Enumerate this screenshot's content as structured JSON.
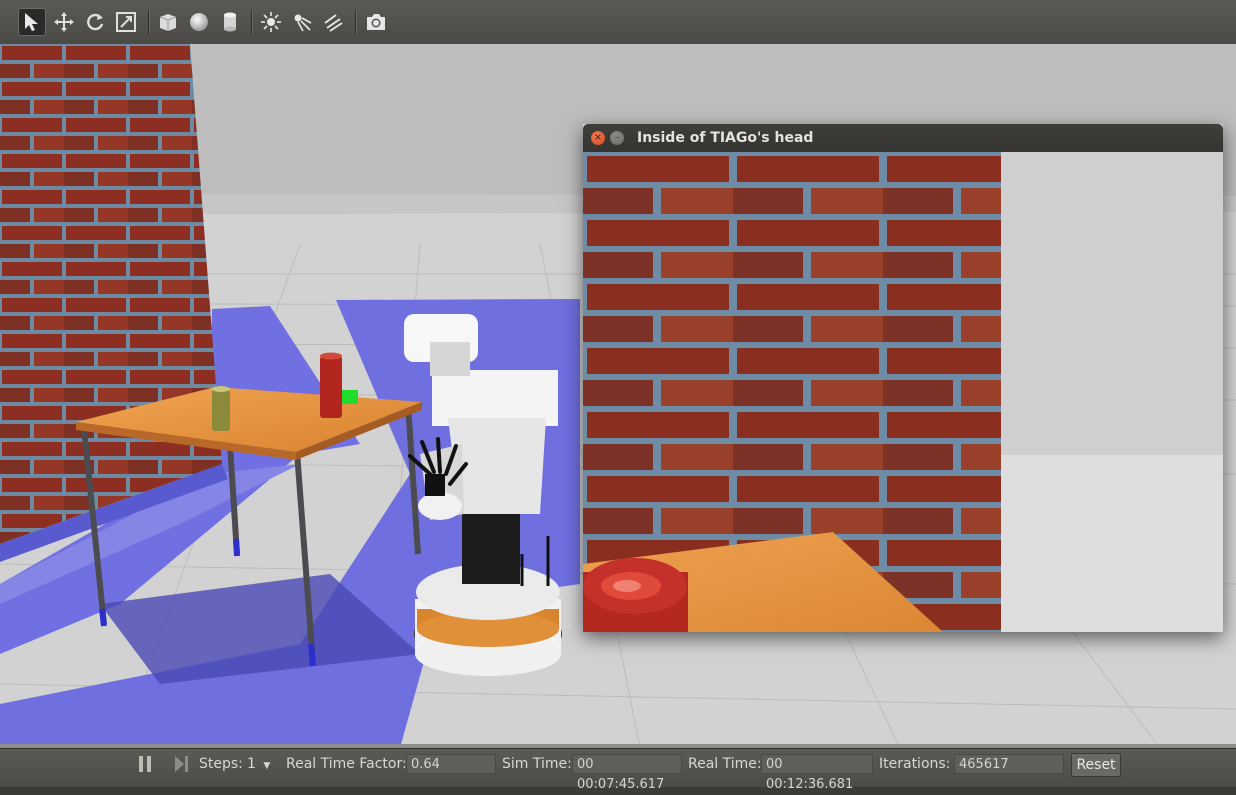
{
  "toolbar": {
    "tools": [
      {
        "icon": "select-arrow-icon",
        "active": true
      },
      {
        "icon": "translate-icon"
      },
      {
        "icon": "rotate-icon"
      },
      {
        "icon": "scale-icon"
      },
      {
        "icon": "box-shape-icon"
      },
      {
        "icon": "sphere-shape-icon"
      },
      {
        "icon": "cylinder-shape-icon"
      },
      {
        "icon": "point-light-icon"
      },
      {
        "icon": "spot-light-icon"
      },
      {
        "icon": "directional-light-icon"
      },
      {
        "icon": "screenshot-camera-icon"
      }
    ]
  },
  "camera_window": {
    "title": "Inside of TIAGo's head",
    "close_symbol": "×",
    "minimize_symbol": "–"
  },
  "statusbar": {
    "steps_label": "Steps:",
    "steps_value": "1",
    "rtf_label": "Real Time Factor:",
    "rtf_value": "0.64",
    "sim_time_label": "Sim Time:",
    "sim_time_value": "00 00:07:45.617",
    "real_time_label": "Real Time:",
    "real_time_value": "00 00:12:36.681",
    "iterations_label": "Iterations:",
    "iterations_value": "465617",
    "reset_label": "Reset"
  },
  "colors": {
    "toolbar_bg": "#55544f",
    "floor": "#d0d0d0",
    "laser_scan": "#6f6fe0",
    "brick": "#8e2f22",
    "table_top": "#e19445",
    "robot_body": "#eeeeee",
    "robot_base_ring": "#d98a30"
  }
}
